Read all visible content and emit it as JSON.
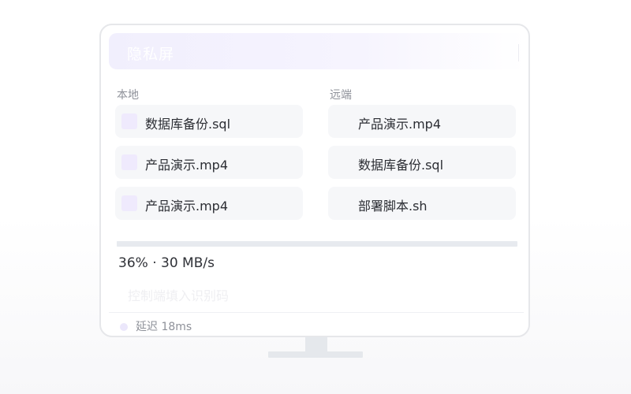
{
  "window": {
    "title": "隐私屏"
  },
  "local": {
    "label": "本地",
    "files": [
      {
        "name": "数据库备份.sql"
      },
      {
        "name": "产品演示.mp4"
      },
      {
        "name": "产品演示.mp4"
      }
    ]
  },
  "remote": {
    "label": "远端",
    "files": [
      {
        "name": "产品演示.mp4"
      },
      {
        "name": "数据库备份.sql"
      },
      {
        "name": "部署脚本.sh"
      }
    ]
  },
  "transfer": {
    "progress_percent": 36,
    "status_text": "36% · 30 MB/s"
  },
  "code_input": {
    "placeholder": "控制端填入识别码"
  },
  "footer": {
    "latency_text": "延迟 18ms"
  },
  "colors": {
    "accent_light": "#efeafd",
    "row_bg": "#f6f7f9",
    "track": "#e7eaef"
  }
}
